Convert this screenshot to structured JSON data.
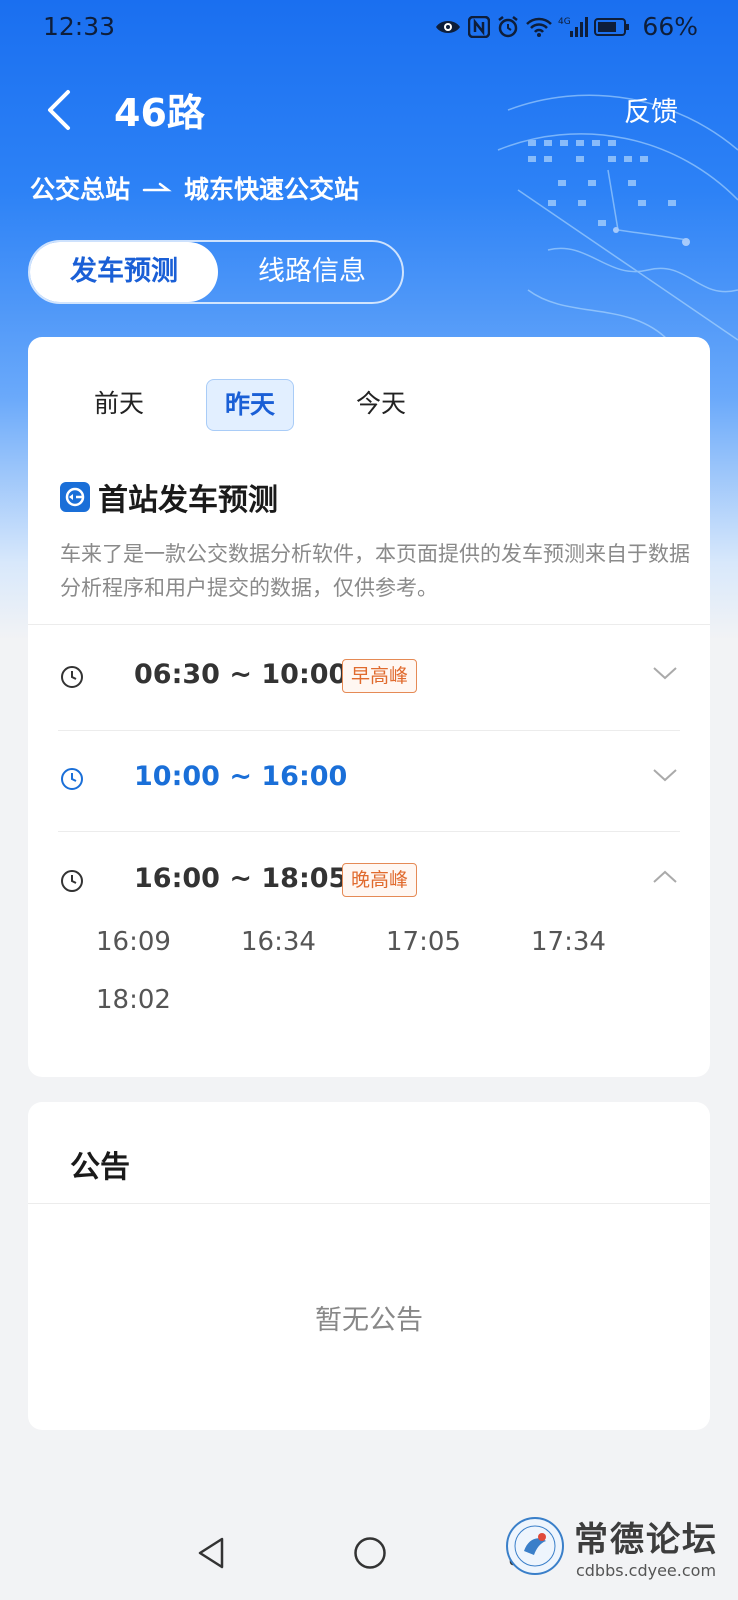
{
  "status_bar": {
    "time": "12:33",
    "network": "4G",
    "battery": "66%"
  },
  "header": {
    "route": "46路",
    "feedback": "反馈",
    "origin": "公交总站",
    "destination": "城东快速公交站"
  },
  "tabs": [
    {
      "label": "发车预测",
      "active": true
    },
    {
      "label": "线路信息",
      "active": false
    }
  ],
  "days": [
    {
      "label": "前天",
      "active": false
    },
    {
      "label": "昨天",
      "active": true
    },
    {
      "label": "今天",
      "active": false
    }
  ],
  "forecast": {
    "title": "首站发车预测",
    "description": "车来了是一款公交数据分析软件，本页面提供的发车预测来自于数据分析程序和用户提交的数据，仅供参考。",
    "slots": [
      {
        "range": "06:30 ~ 10:00",
        "badge": "早高峰",
        "expanded": false
      },
      {
        "range": "10:00 ~ 16:00",
        "badge": "",
        "expanded": false
      },
      {
        "range": "16:00 ~ 18:05",
        "badge": "晚高峰",
        "expanded": true
      }
    ],
    "departures": [
      "16:09",
      "16:34",
      "17:05",
      "17:34",
      "18:02"
    ]
  },
  "notice": {
    "title": "公告",
    "empty": "暂无公告"
  },
  "watermark": {
    "title": "常德论坛",
    "url": "cdbbs.cdyee.com"
  },
  "colors": {
    "accent": "#1a6fd8",
    "peak_badge": "#e06b2e"
  }
}
